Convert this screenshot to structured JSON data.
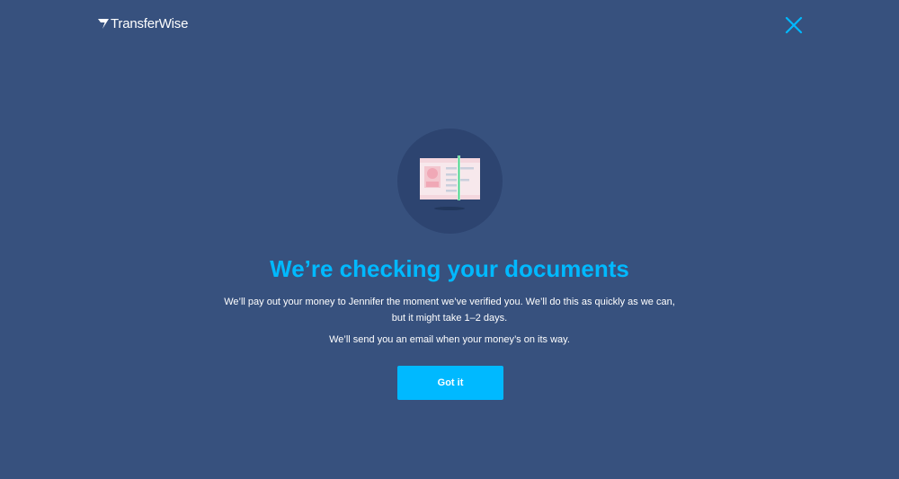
{
  "header": {
    "brand_name": "TransferWise",
    "logo_icon": "transferwise-flag-icon",
    "close_icon": "close-icon"
  },
  "main": {
    "illustration_icon": "id-document-scan-icon",
    "title": "We’re checking your documents",
    "description": "We’ll pay out your money to Jennifer the moment we’ve verified you. We’ll do this as quickly as we can, but it might take 1–2 days.",
    "email_note": "We’ll send you an email when your money’s on its way.",
    "primary_button_label": "Got it"
  },
  "colors": {
    "background": "#37517e",
    "circle": "#2d4470",
    "accent": "#00b9ff",
    "text": "#ffffff"
  }
}
